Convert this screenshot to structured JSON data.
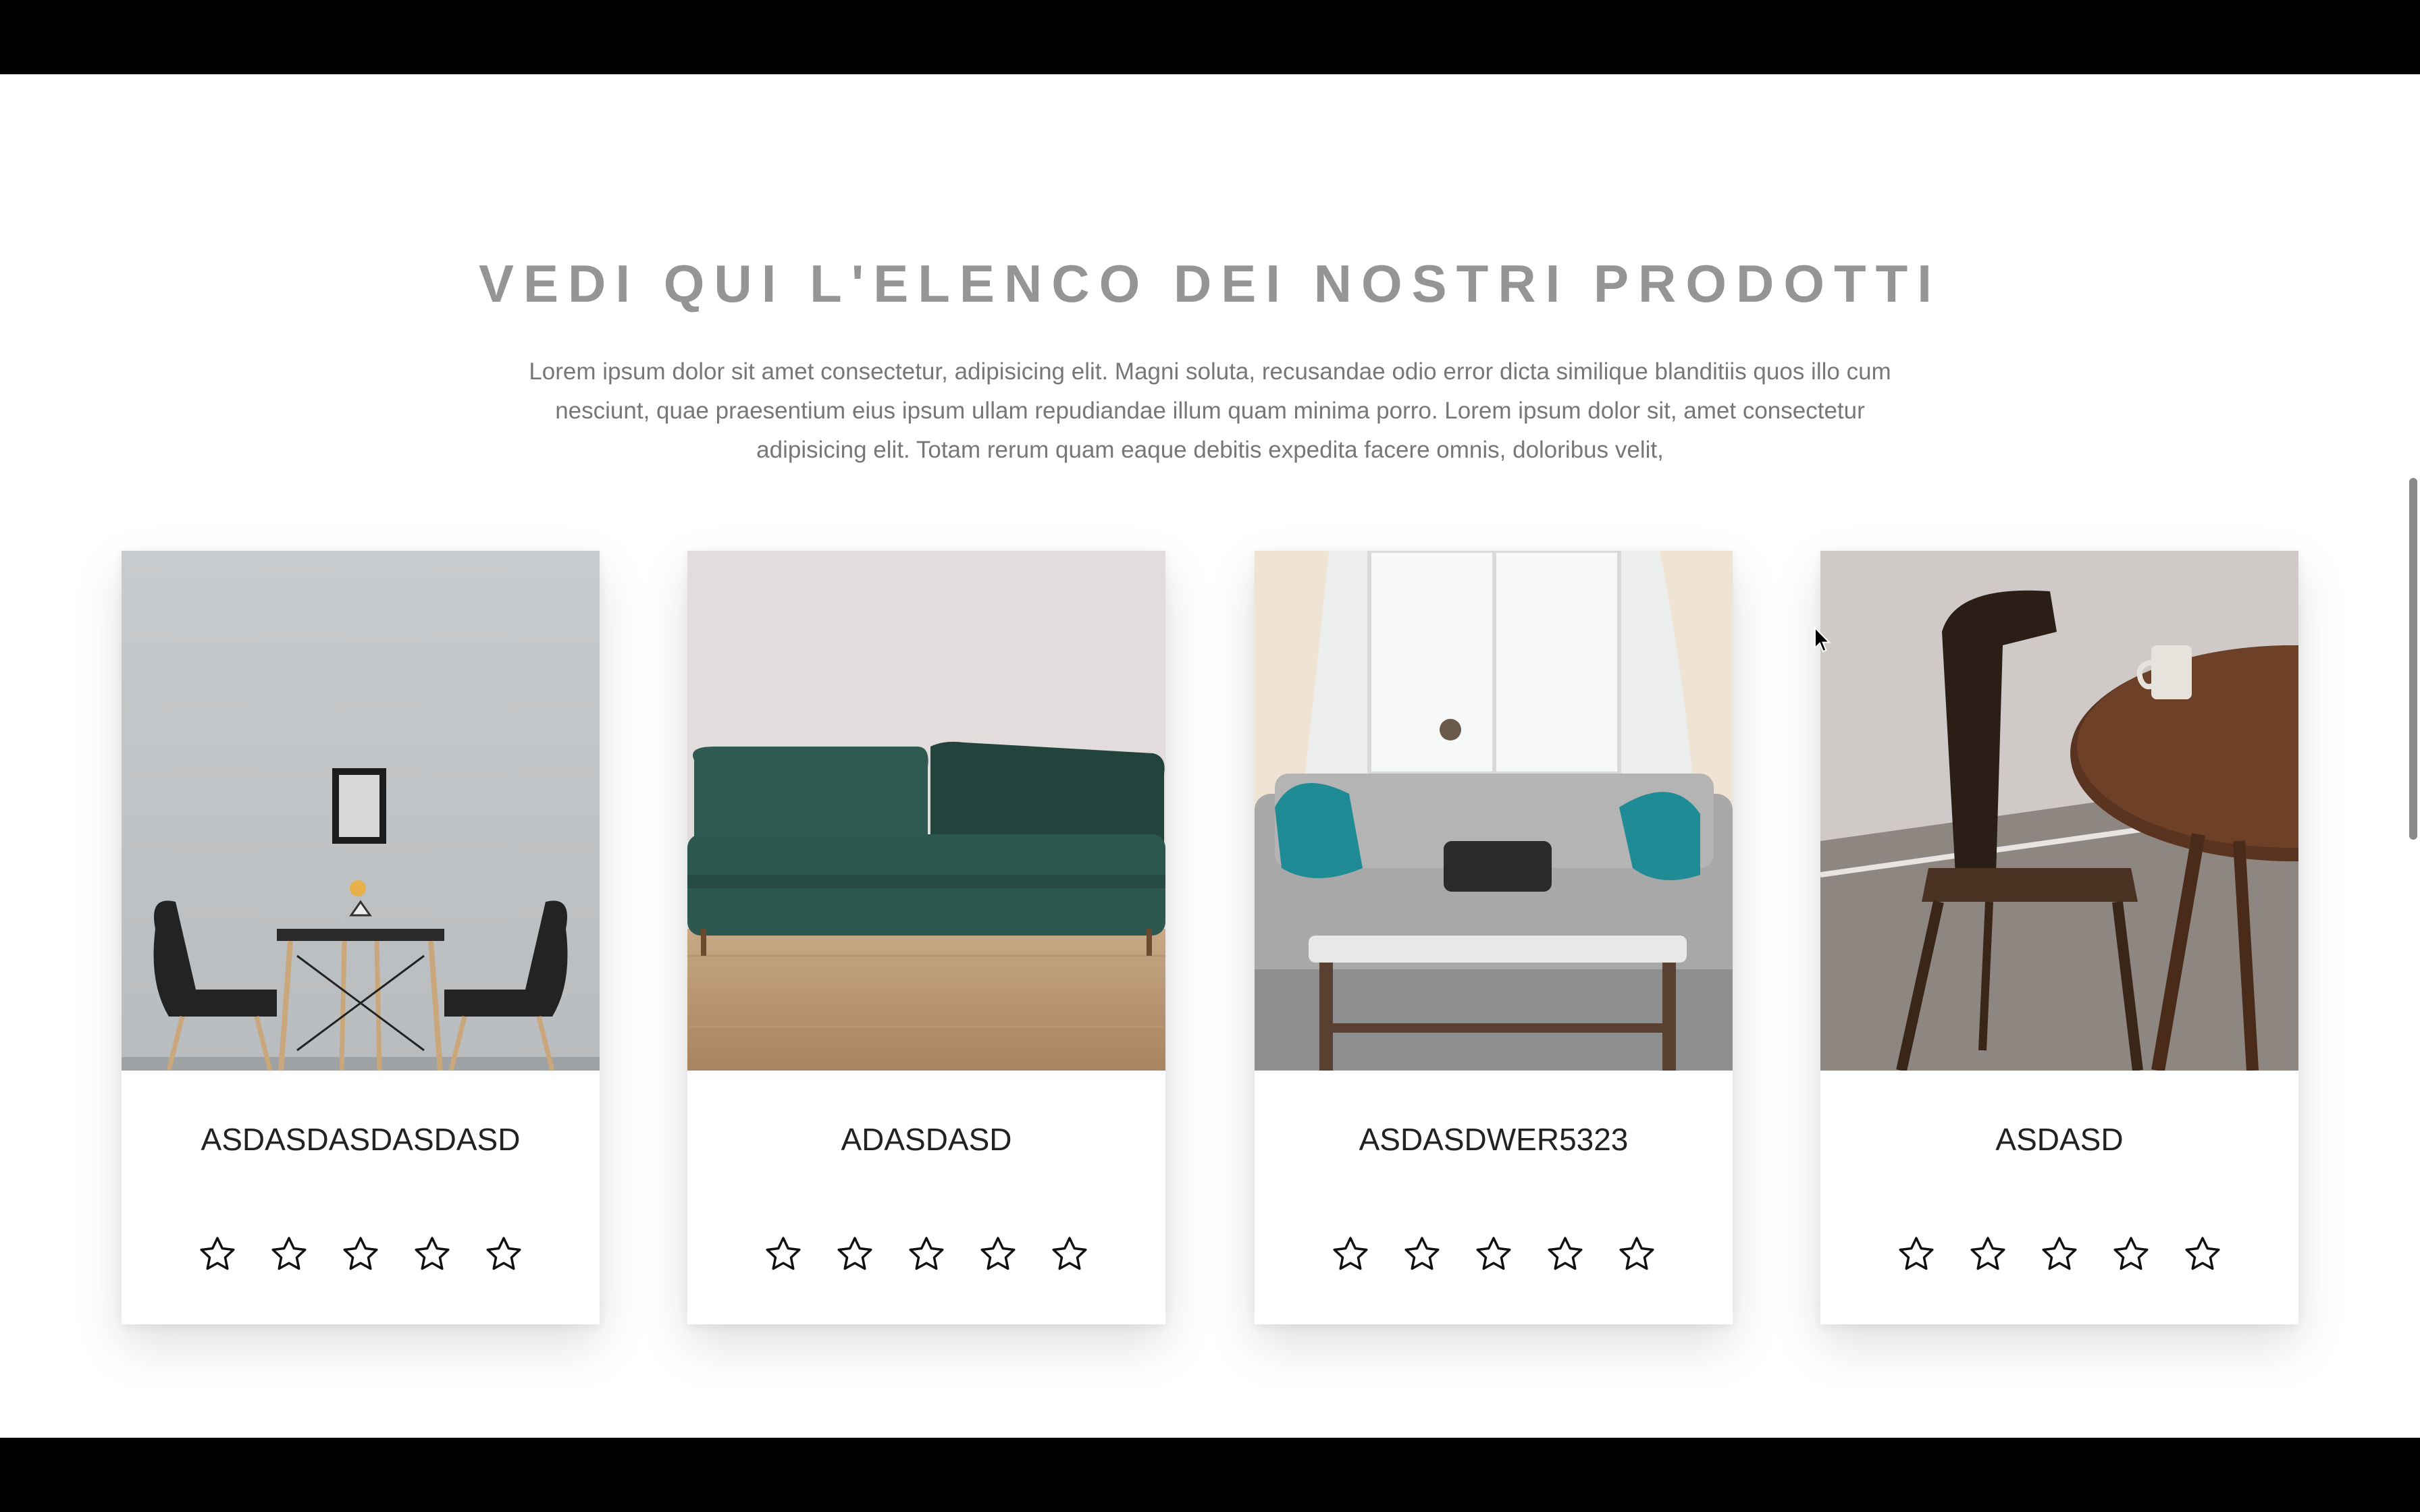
{
  "section": {
    "title": "VEDI QUI L'ELENCO DEI NOSTRI PRODOTTI",
    "description": "Lorem ipsum dolor sit amet consectetur, adipisicing elit. Magni soluta, recusandae odio error dicta similique blanditiis quos illo cum nesciunt, quae praesentium eius ipsum ullam repudiandae illum quam minima porro. Lorem ipsum dolor sit, amet consectetur adipisicing elit. Totam rerum quam eaque debitis expedita facere omnis, doloribus velit,"
  },
  "products": [
    {
      "name": "ASDASDASDASDASD",
      "image": "dining-table-two-black-chairs",
      "rating": 0,
      "max_rating": 5
    },
    {
      "name": "ADASDASD",
      "image": "green-velvet-sofa",
      "rating": 0,
      "max_rating": 5
    },
    {
      "name": "ASDASDWER5323",
      "image": "grey-sofa-with-coffee-table",
      "rating": 0,
      "max_rating": 5
    },
    {
      "name": "ASDASD",
      "image": "wooden-chair-round-table",
      "rating": 0,
      "max_rating": 5
    }
  ],
  "colors": {
    "title": "#959595",
    "text": "#777777",
    "product_name": "#222222",
    "background": "#ffffff",
    "frame": "#000000"
  }
}
